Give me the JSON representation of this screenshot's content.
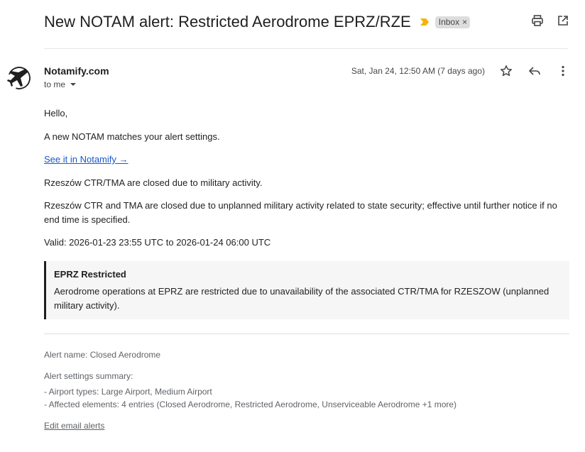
{
  "email": {
    "subject": "New NOTAM alert: Restricted Aerodrome EPRZ/RZE",
    "label": "Inbox",
    "label_remove": "×",
    "sender": "Notamify.com",
    "recipient": "to me",
    "date": "Sat, Jan 24, 12:50 AM (7 days ago)"
  },
  "body": {
    "greeting": "Hello,",
    "intro": "A new NOTAM matches your alert settings.",
    "link_text": "See it in Notamify →",
    "summary": "Rzeszów CTR/TMA are closed due to military activity.",
    "detail": "Rzeszów CTR and TMA are closed due to unplanned military activity related to state security; effective until further notice if no end time is specified.",
    "valid": "Valid: 2026-01-23 23:55 UTC to 2026-01-24 06:00 UTC",
    "callout_title": "EPRZ Restricted",
    "callout_text": "Aerodrome operations at EPRZ are restricted due to unavailability of the associated CTR/TMA for RZESZOW (unplanned military activity)."
  },
  "footer": {
    "alert_name": "Alert name: Closed Aerodrome",
    "settings_heading": "Alert settings summary:",
    "settings_items": [
      "- Airport types: Large Airport, Medium Airport",
      "- Affected elements: 4 entries (Closed Aerodrome, Restricted Aerodrome, Unserviceable Aerodrome +1 more)"
    ],
    "edit_link": "Edit email alerts"
  },
  "icons": {
    "importance": "importance-marker-icon",
    "print": "print-icon",
    "open_new_window": "open-in-new-window-icon",
    "star": "star-icon",
    "reply": "reply-icon",
    "more": "more-vertical-icon",
    "dropdown": "caret-down-icon",
    "avatar": "airplane-logo-icon"
  },
  "colors": {
    "importance": "#f4b400",
    "link": "#1a57c8",
    "label_bg": "#dddddd",
    "callout_bg": "#f6f6f6",
    "callout_border": "#1f1f1f"
  }
}
